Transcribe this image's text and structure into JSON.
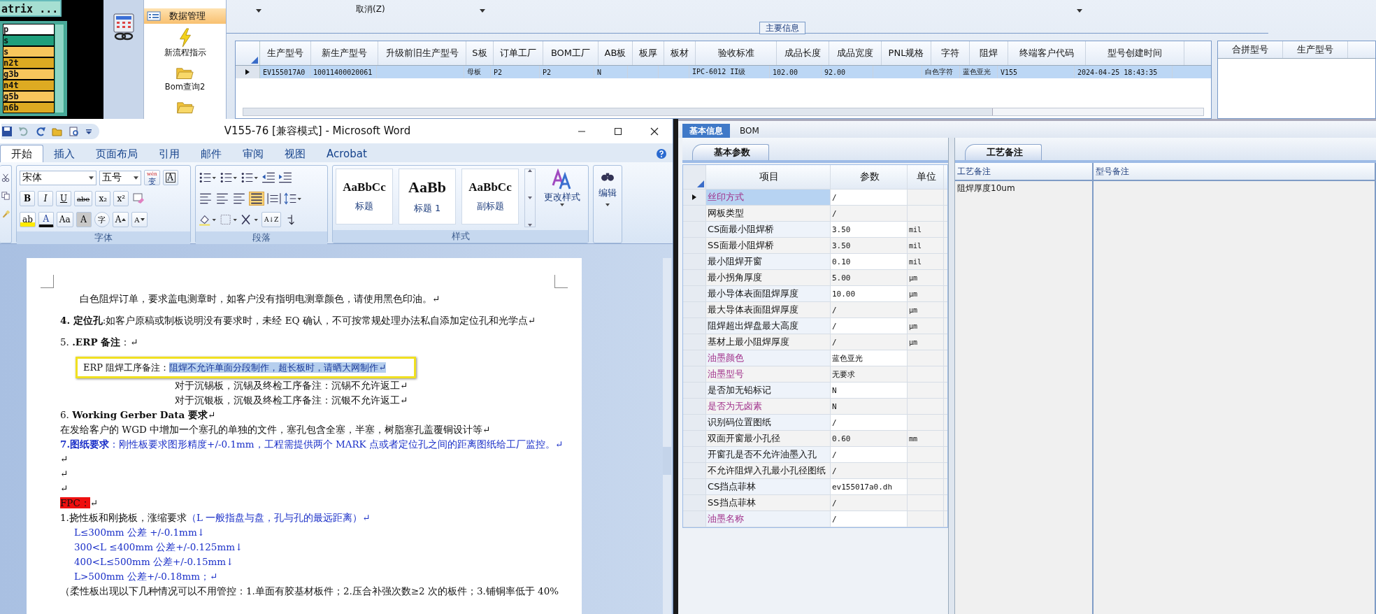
{
  "matrix_app": {
    "title": "atrix ...",
    "layers": [
      {
        "label": "p",
        "color": "#ffffff"
      },
      {
        "label": "s",
        "color": "#1f9f7c"
      },
      {
        "label": "s",
        "color": "#f7c65c"
      },
      {
        "label": "n2t",
        "color": "#ddaa22"
      },
      {
        "label": "g3b",
        "color": "#f7c65c"
      },
      {
        "label": "n4t",
        "color": "#ddaa22"
      },
      {
        "label": "g5b",
        "color": "#f7c65c"
      },
      {
        "label": "n6b",
        "color": "#ddaa22"
      }
    ]
  },
  "erp_app": {
    "nav_sections": [
      {
        "label": "数据管理",
        "selected": true
      }
    ],
    "nav_items": [
      {
        "label": "新流程指示",
        "kind": "bolt"
      },
      {
        "label": "Bom查询2",
        "kind": "folder"
      }
    ],
    "toolbar": {
      "cancel_label": "取消(Z)"
    },
    "main_group": {
      "title": "主要信息",
      "columns": [
        "生产型号",
        "新生产型号",
        "升级前旧生产型号",
        "S板",
        "订单工厂",
        "BOM工厂",
        "AB板",
        "板厚",
        "板材",
        "验收标准",
        "成品长度",
        "成品宽度",
        "PNL规格",
        "字符",
        "阻焊",
        "终端客户代码",
        "型号创建时间"
      ],
      "rows": [
        {
          "selected": true,
          "cells": [
            "EV155017A0",
            "10011400020061",
            "",
            "母板",
            "P2",
            "P2",
            "N",
            "",
            "",
            "IPC-6012 II级",
            "102.00",
            "92.00",
            "",
            "白色字符",
            "蓝色亚光",
            "V155",
            "2024-04-25 18:43:35"
          ]
        }
      ]
    },
    "side_grid": {
      "columns": [
        "合拼型号",
        "生产型号"
      ]
    }
  },
  "word": {
    "title": "V155-76 [兼容模式] - Microsoft Word",
    "tabs": [
      {
        "label": "开始",
        "selected": true
      },
      {
        "label": "插入",
        "selected": false
      },
      {
        "label": "页面布局",
        "selected": false
      },
      {
        "label": "引用",
        "selected": false
      },
      {
        "label": "邮件",
        "selected": false
      },
      {
        "label": "审阅",
        "selected": false
      },
      {
        "label": "视图",
        "selected": false
      },
      {
        "label": "Acrobat",
        "selected": false
      }
    ],
    "font": {
      "family": "宋体",
      "size": "五号",
      "phonetic": "wén",
      "phonetic_char": "变",
      "boxed": "A",
      "format_buttons": [
        "B",
        "I",
        "U",
        "abe",
        "x₂",
        "x²"
      ],
      "highlight": "ab",
      "font_color": "A",
      "case": "Aa",
      "shade": "A",
      "enclose": "字",
      "grow": "A",
      "shrink": "A",
      "label": "字体"
    },
    "paragraph": {
      "label": "段落",
      "sort": "A↓Z"
    },
    "styles": {
      "label": "样式",
      "items": [
        {
          "sample": "AaBbCc",
          "label": "标题",
          "kind": "normal"
        },
        {
          "sample": "AaBb",
          "label": "标题 1",
          "kind": "big"
        },
        {
          "sample": "AaBbCc",
          "label": "副标题",
          "kind": "normal"
        }
      ],
      "change": "更改样式"
    },
    "editing": {
      "label": "编辑"
    },
    "paragraphs": [
      {
        "kind": "lead",
        "text": "白色阻焊订单，要求盖电测章时，如客户没有指明电测章颜色，请使用黑色印油。↵"
      },
      {
        "kind": "item",
        "text": "**4. 定位孔**:如客户原稿或制板说明没有要求时，未经 EQ 确认，不可按常规处理办法私自添加定位孔和光学点↵"
      },
      {
        "kind": "item",
        "text": "5. **.ERP 备注**：↵"
      },
      {
        "kind": "boxed",
        "text": "ERP 阻焊工序备注：",
        "note": "阻焊不允许单面分段制作，超长板时，请晒大网制作↵"
      },
      {
        "kind": "sub",
        "text": "对于沉锡板，沉锡及终检工序备注：沉锡不允许返工↵"
      },
      {
        "kind": "sub",
        "text": "对于沉银板，沉银及终检工序备注：沉银不允许返工↵"
      },
      {
        "kind": "plain",
        "text": "6. **Working Gerber Data 要求**↵"
      },
      {
        "kind": "plain",
        "text": "在发给客户的 WGD 中增加一个塞孔的单独的文件，塞孔包含全塞，半塞，树脂塞孔盖覆铜设计等↵"
      },
      {
        "kind": "blue",
        "text": "**7.图纸要求**：刚性板要求图形精度+/-0.1mm，工程需提供两个 MARK 点或者定位孔之间的距离图纸给工厂监控。↵"
      },
      {
        "kind": "plain",
        "text": "↵"
      },
      {
        "kind": "plain",
        "text": "↵"
      },
      {
        "kind": "plain",
        "text": "↵"
      },
      {
        "kind": "flag",
        "text": "FPC：",
        "note": "↵"
      },
      {
        "kind": "plain",
        "text": "1.挠性板和刚挠板，涨缩要求",
        "note": "（L 一般指盘与盘，孔与孔的最远距离）↵"
      },
      {
        "kind": "blue-indent",
        "text": "L≤300mm 公差 +/-0.1mm↓"
      },
      {
        "kind": "blue-indent",
        "text": "300<L ≤400mm 公差+/-0.125mm↓"
      },
      {
        "kind": "blue-indent",
        "text": "400<L≤500mm 公差+/-0.15mm↓"
      },
      {
        "kind": "blue-indent",
        "text": "L>500mm 公差+/-0.18mm；↵"
      },
      {
        "kind": "plain",
        "text": "（柔性板出现以下几种情况可以不用管控：1.单面有胶基材板件；2.压合补强次数≥2 次的板件；3.铺铜率低于 40%"
      }
    ]
  },
  "detail_panel": {
    "tabs": [
      {
        "label": "基本信息",
        "selected": true
      },
      {
        "label": "BOM",
        "selected": false
      }
    ],
    "params": {
      "tab": "基本参数",
      "columns": [
        "项目",
        "参数",
        "单位"
      ],
      "rows": [
        {
          "name": "丝印方式",
          "value": "/",
          "unit": "",
          "highlighted": true,
          "selected": true
        },
        {
          "name": "网板类型",
          "value": "/",
          "unit": "",
          "highlighted": false,
          "selected": false
        },
        {
          "name": "CS面最小阻焊桥",
          "value": "3.50",
          "unit": "mil",
          "highlighted": false,
          "selected": false
        },
        {
          "name": "SS面最小阻焊桥",
          "value": "3.50",
          "unit": "mil",
          "highlighted": false,
          "selected": false
        },
        {
          "name": "最小阻焊开窗",
          "value": "0.10",
          "unit": "mil",
          "highlighted": false,
          "selected": false
        },
        {
          "name": "最小拐角厚度",
          "value": "5.00",
          "unit": "μm",
          "highlighted": false,
          "selected": false
        },
        {
          "name": "最小导体表面阻焊厚度",
          "value": "10.00",
          "unit": "μm",
          "highlighted": false,
          "selected": false
        },
        {
          "name": "最大导体表面阻焊厚度",
          "value": "/",
          "unit": "μm",
          "highlighted": false,
          "selected": false
        },
        {
          "name": "阻焊超出焊盘最大高度",
          "value": "/",
          "unit": "μm",
          "highlighted": false,
          "selected": false
        },
        {
          "name": "基材上最小阻焊厚度",
          "value": "/",
          "unit": "μm",
          "highlighted": false,
          "selected": false
        },
        {
          "name": "油墨颜色",
          "value": "蓝色亚光",
          "unit": "",
          "highlighted": true,
          "selected": false
        },
        {
          "name": "油墨型号",
          "value": "无要求",
          "unit": "",
          "highlighted": true,
          "selected": false
        },
        {
          "name": "是否加无铅标记",
          "value": "N",
          "unit": "",
          "highlighted": false,
          "selected": false
        },
        {
          "name": "是否为无卤素",
          "value": "N",
          "unit": "",
          "highlighted": true,
          "selected": false
        },
        {
          "name": "识别码位置图纸",
          "value": "/",
          "unit": "",
          "highlighted": false,
          "selected": false
        },
        {
          "name": "双面开窗最小孔径",
          "value": "0.60",
          "unit": "mm",
          "highlighted": false,
          "selected": false
        },
        {
          "name": "开窗孔是否不允许油墨入孔",
          "value": "/",
          "unit": "",
          "highlighted": false,
          "selected": false
        },
        {
          "name": "不允许阻焊入孔最小孔径图纸",
          "value": "/",
          "unit": "",
          "highlighted": false,
          "selected": false
        },
        {
          "name": "CS挡点菲林",
          "value": "ev155017a0.dh",
          "unit": "",
          "highlighted": false,
          "selected": false
        },
        {
          "name": "SS挡点菲林",
          "value": "/",
          "unit": "",
          "highlighted": false,
          "selected": false
        },
        {
          "name": "油墨名称",
          "value": "/",
          "unit": "",
          "highlighted": true,
          "selected": false
        }
      ]
    },
    "process": {
      "tab": "工艺备注",
      "columns": [
        "工艺备注",
        "型号备注"
      ],
      "process_note": "阻焊厚度10um"
    }
  }
}
